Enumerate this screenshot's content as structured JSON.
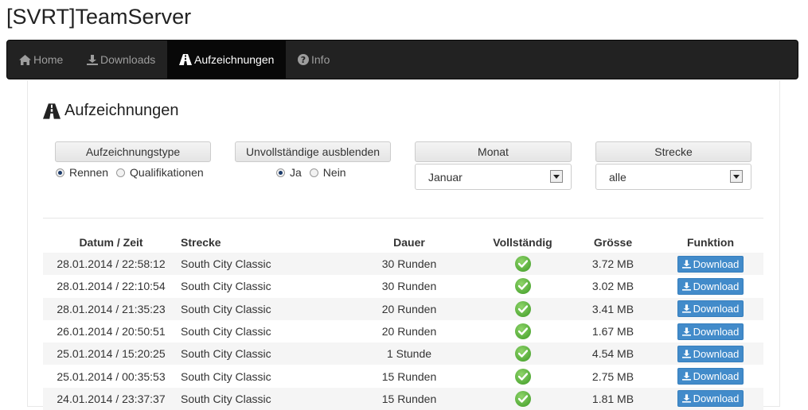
{
  "app": {
    "title": "[SVRT]TeamServer"
  },
  "nav": {
    "items": [
      {
        "label": "Home",
        "icon": "home-icon"
      },
      {
        "label": "Downloads",
        "icon": "download-icon"
      },
      {
        "label": "Aufzeichnungen",
        "icon": "road-icon",
        "active": true
      },
      {
        "label": "Info",
        "icon": "question-circle-icon"
      }
    ]
  },
  "section": {
    "title": "Aufzeichnungen",
    "icon": "road-icon"
  },
  "filters": {
    "type": {
      "label": "Aufzeichnungstype",
      "options": [
        "Rennen",
        "Qualifikationen"
      ],
      "selected": "Rennen"
    },
    "incomplete": {
      "label": "Unvollständige ausblenden",
      "options": [
        "Ja",
        "Nein"
      ],
      "selected": "Ja"
    },
    "month": {
      "label": "Monat",
      "value": "Januar"
    },
    "track": {
      "label": "Strecke",
      "value": "alle"
    }
  },
  "table": {
    "headers": [
      "Datum / Zeit",
      "Strecke",
      "Dauer",
      "Vollständig",
      "Grösse",
      "Funktion"
    ],
    "download_label": "Download",
    "rows": [
      {
        "datetime": "28.01.2014 / 22:58:12",
        "track": "South City Classic",
        "duration": "30 Runden",
        "size": "3.72 MB"
      },
      {
        "datetime": "28.01.2014 / 22:10:54",
        "track": "South City Classic",
        "duration": "30 Runden",
        "size": "3.02 MB"
      },
      {
        "datetime": "28.01.2014 / 21:35:23",
        "track": "South City Classic",
        "duration": "20 Runden",
        "size": "3.41 MB"
      },
      {
        "datetime": "26.01.2014 / 20:50:51",
        "track": "South City Classic",
        "duration": "20 Runden",
        "size": "1.67 MB"
      },
      {
        "datetime": "25.01.2014 / 15:20:25",
        "track": "South City Classic",
        "duration": "1 Stunde",
        "size": "4.54 MB"
      },
      {
        "datetime": "25.01.2014 / 00:35:53",
        "track": "South City Classic",
        "duration": "15 Runden",
        "size": "2.75 MB"
      },
      {
        "datetime": "24.01.2014 / 23:37:37",
        "track": "South City Classic",
        "duration": "15 Runden",
        "size": "1.81 MB"
      }
    ]
  },
  "colors": {
    "navbar": "#222222",
    "accent": "#428bca",
    "complete": "#4caf2a"
  }
}
